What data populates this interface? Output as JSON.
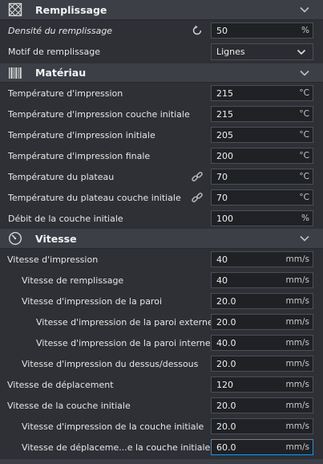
{
  "sections": {
    "infill": {
      "title": "Remplissage",
      "icon": "infill-grid-icon",
      "density": {
        "label": "Densité du remplissage",
        "value": "50",
        "unit": "%"
      },
      "pattern": {
        "label": "Motif de remplissage",
        "value": "Lignes"
      }
    },
    "material": {
      "title": "Matériau",
      "icon": "material-barcode-icon",
      "rows": [
        {
          "label": "Température d'impression",
          "value": "215",
          "unit": "°C",
          "link": false
        },
        {
          "label": "Température d'impression couche initiale",
          "value": "215",
          "unit": "°C",
          "link": false
        },
        {
          "label": "Température d'impression initiale",
          "value": "205",
          "unit": "°C",
          "link": false
        },
        {
          "label": "Température d'impression finale",
          "value": "200",
          "unit": "°C",
          "link": false
        },
        {
          "label": "Température du plateau",
          "value": "70",
          "unit": "°C",
          "link": true
        },
        {
          "label": "Température du plateau couche initiale",
          "value": "70",
          "unit": "°C",
          "link": true
        },
        {
          "label": "Débit de la couche initiale",
          "value": "100",
          "unit": "%",
          "link": false
        }
      ]
    },
    "speed": {
      "title": "Vitesse",
      "icon": "speed-gauge-icon",
      "rows": [
        {
          "label": "Vitesse d'impression",
          "value": "40",
          "unit": "mm/s",
          "indent": 0
        },
        {
          "label": "Vitesse de remplissage",
          "value": "40",
          "unit": "mm/s",
          "indent": 1
        },
        {
          "label": "Vitesse d'impression de la paroi",
          "value": "20.0",
          "unit": "mm/s",
          "indent": 1
        },
        {
          "label": "Vitesse d'impression de la paroi externe",
          "value": "20.0",
          "unit": "mm/s",
          "indent": 2
        },
        {
          "label": "Vitesse d'impression de la paroi interne",
          "value": "40.0",
          "unit": "mm/s",
          "indent": 2
        },
        {
          "label": "Vitesse d'impression du dessus/dessous",
          "value": "20.0",
          "unit": "mm/s",
          "indent": 1
        },
        {
          "label": "Vitesse de déplacement",
          "value": "120",
          "unit": "mm/s",
          "indent": 0
        },
        {
          "label": "Vitesse de la couche initiale",
          "value": "20.0",
          "unit": "mm/s",
          "indent": 0
        },
        {
          "label": "Vitesse d'impression de la couche initiale",
          "value": "20.0",
          "unit": "mm/s",
          "indent": 1
        },
        {
          "label": "Vitesse de déplaceme...e la couche initiale",
          "value": "60.0",
          "unit": "mm/s",
          "indent": 1,
          "active": true
        }
      ]
    }
  },
  "colors": {
    "accent": "#2f8fd6",
    "panel": "#2e3036",
    "header": "#3c3f46"
  }
}
